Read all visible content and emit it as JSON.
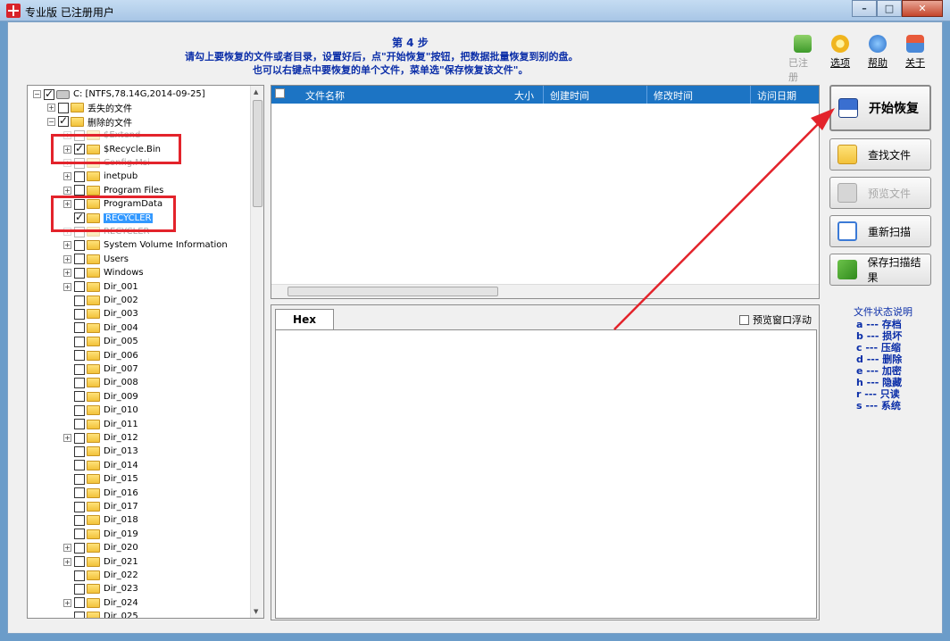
{
  "window": {
    "title": "专业版  已注册用户",
    "btn_min": "–",
    "btn_max": "□",
    "btn_close": "✕"
  },
  "header": {
    "step": "第 4 步",
    "line1": "请勾上要恢复的文件或者目录，设置好后，点\"开始恢复\"按钮，把数据批量恢复到别的盘。",
    "line2": "也可以右键点中要恢复的单个文件，菜单选\"保存恢复该文件\"。"
  },
  "topbar": {
    "registered": "已注册",
    "options": "选项",
    "help": "帮助",
    "about": "关于"
  },
  "tree": {
    "items": [
      {
        "label": "C:  [NTFS,78.14G,2014-09-25]"
      },
      {
        "label": "丢失的文件"
      },
      {
        "label": "删除的文件"
      },
      {
        "label": "$Extend"
      },
      {
        "label": "$Recycle.Bin"
      },
      {
        "label": "Config.Msi"
      },
      {
        "label": "inetpub"
      },
      {
        "label": "Program Files"
      },
      {
        "label": "ProgramData"
      },
      {
        "label": "RECYCLER"
      },
      {
        "label": "RECYCLER"
      },
      {
        "label": "System Volume Information"
      },
      {
        "label": "Users"
      },
      {
        "label": "Windows"
      },
      {
        "label": "Dir_001"
      },
      {
        "label": "Dir_002"
      },
      {
        "label": "Dir_003"
      },
      {
        "label": "Dir_004"
      },
      {
        "label": "Dir_005"
      },
      {
        "label": "Dir_006"
      },
      {
        "label": "Dir_007"
      },
      {
        "label": "Dir_008"
      },
      {
        "label": "Dir_009"
      },
      {
        "label": "Dir_010"
      },
      {
        "label": "Dir_011"
      },
      {
        "label": "Dir_012"
      },
      {
        "label": "Dir_013"
      },
      {
        "label": "Dir_014"
      },
      {
        "label": "Dir_015"
      },
      {
        "label": "Dir_016"
      },
      {
        "label": "Dir_017"
      },
      {
        "label": "Dir_018"
      },
      {
        "label": "Dir_019"
      },
      {
        "label": "Dir_020"
      },
      {
        "label": "Dir_021"
      },
      {
        "label": "Dir_022"
      },
      {
        "label": "Dir_023"
      },
      {
        "label": "Dir_024"
      },
      {
        "label": "Dir_025"
      }
    ]
  },
  "filelist": {
    "columns": [
      "文件名称",
      "大小",
      "创建时间",
      "修改时间",
      "访问日期"
    ]
  },
  "preview": {
    "tab": "Hex",
    "float_label": "预览窗口浮动"
  },
  "actions": {
    "start": "开始恢复",
    "find": "查找文件",
    "preview": "预览文件",
    "rescan": "重新扫描",
    "save": "保存扫描结果"
  },
  "legend": {
    "title": "文件状态说明",
    "items": [
      "a --- 存档",
      "b --- 损坏",
      "c --- 压缩",
      "d --- 删除",
      "e --- 加密",
      "h --- 隐藏",
      "r --- 只读",
      "s --- 系统"
    ]
  },
  "colors": {
    "instruction_blue": "#0b2ea8",
    "header_blue": "#1c74c4",
    "highlight_red": "#e3232b"
  }
}
